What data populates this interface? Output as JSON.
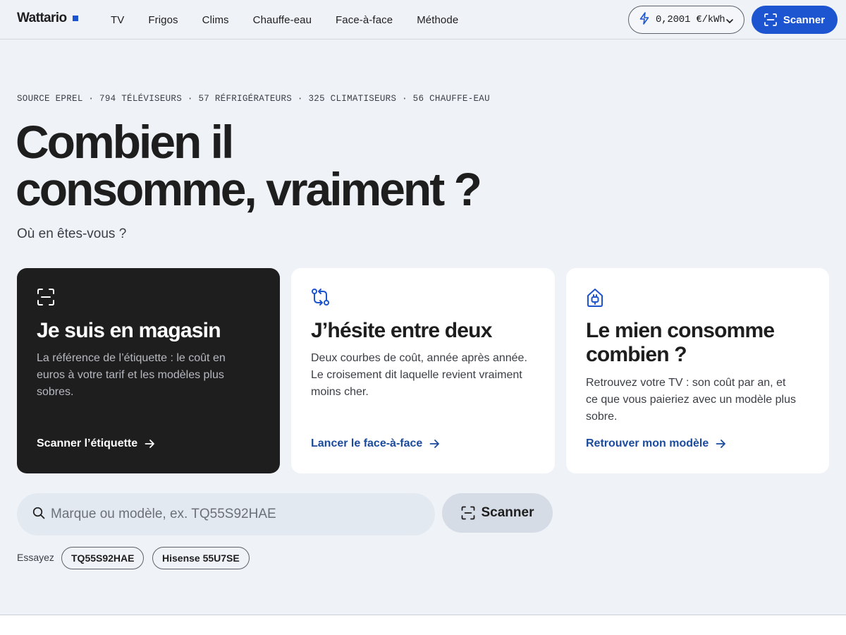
{
  "header": {
    "brand": "Wattario",
    "nav": [
      "TV",
      "Frigos",
      "Clims",
      "Chauffe-eau",
      "Face-à-face",
      "Méthode"
    ],
    "price": "0,2001 €/kWh",
    "scan_label": "Scanner"
  },
  "hero": {
    "stats": "SOURCE EPREL · 794 TÉLÉVISEURS · 57 RÉFRIGÉRATEURS · 325 CLIMATISEURS · 56 CHAUFFE-EAU",
    "title_line1": "Combien il",
    "title_line2": "consomme, vraiment ?",
    "subtitle": "Où en êtes-vous ?"
  },
  "cards": [
    {
      "icon": "scan-icon",
      "title": "Je suis en magasin",
      "text": "La référence de l’étiquette : le coût en euros à votre tarif et les modèles plus sobres.",
      "cta": "Scanner l’étiquette"
    },
    {
      "icon": "compare-arrows-icon",
      "title": "J’hésite entre deux",
      "text": "Deux courbes de coût, année après année. Le croisement dit laquelle revient vraiment moins cher.",
      "cta": "Lancer le face-à-face"
    },
    {
      "icon": "home-plug-icon",
      "title": "Le mien consomme combien ?",
      "text": "Retrouvez votre TV : son coût par an, et ce que vous paieriez avec un modèle plus sobre.",
      "cta": "Retrouver mon modèle"
    }
  ],
  "search": {
    "placeholder": "Marque ou modèle, ex. TQ55S92HAE",
    "scan_label": "Scanner",
    "try_label": "Essayez",
    "suggestions": [
      "TQ55S92HAE",
      "Hisense 55U7SE"
    ]
  },
  "colors": {
    "accent": "#1d55d1",
    "link": "#1a4b9c",
    "background": "#eff3f8",
    "dark_card": "#1e1e1e"
  }
}
